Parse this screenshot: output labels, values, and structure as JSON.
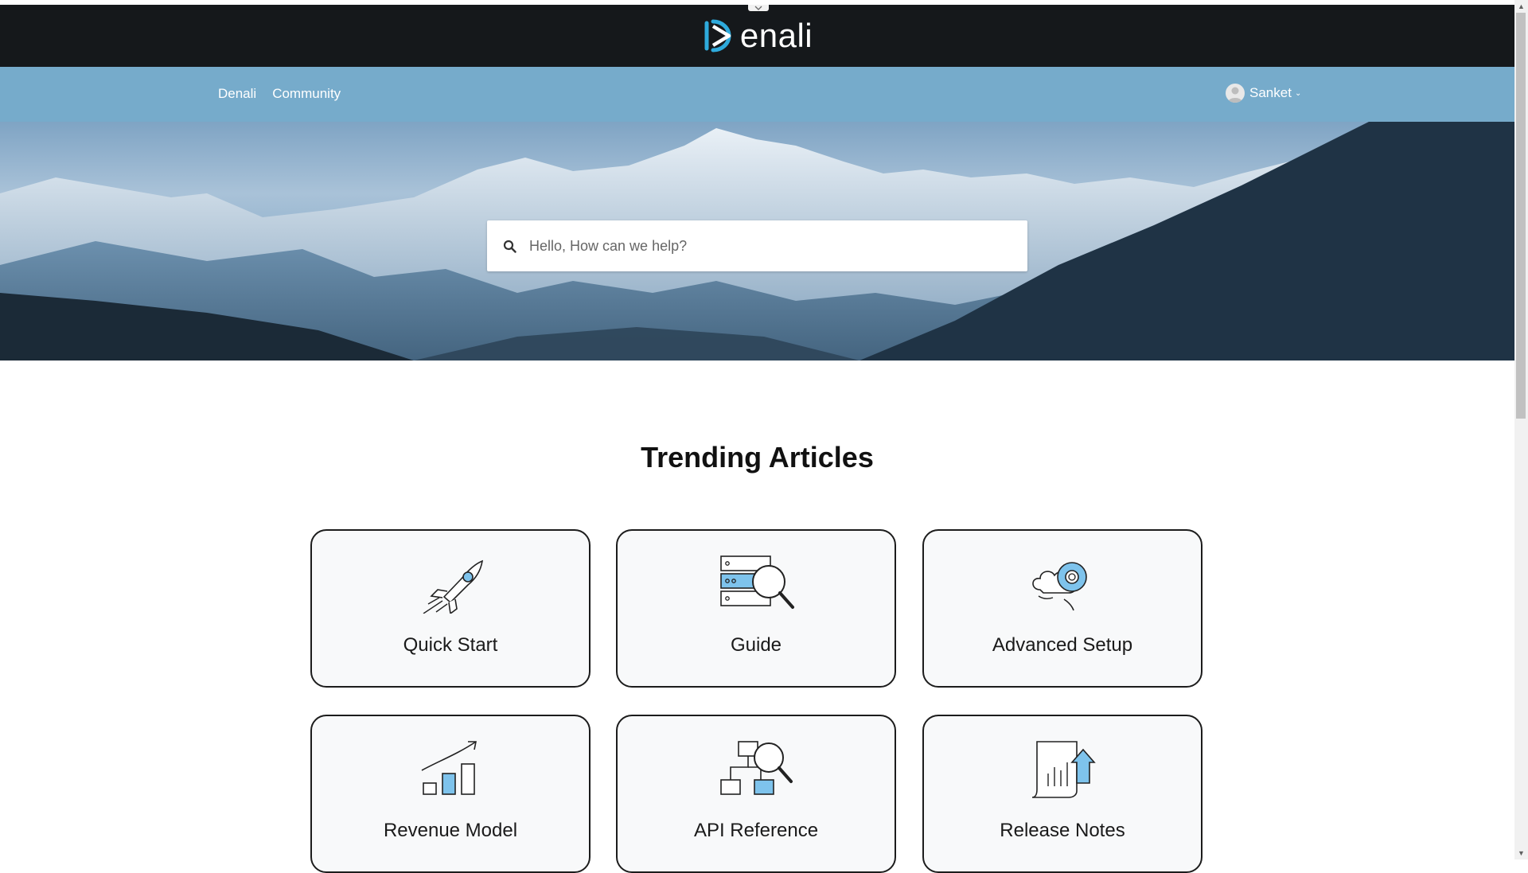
{
  "brand": {
    "logo_text": "enali"
  },
  "nav": {
    "links": [
      "Denali",
      "Community"
    ]
  },
  "user": {
    "name": "Sanket"
  },
  "search": {
    "placeholder": "Hello, How can we help?"
  },
  "trending": {
    "title": "Trending Articles",
    "cards": [
      {
        "label": "Quick Start",
        "icon": "rocket-icon"
      },
      {
        "label": "Guide",
        "icon": "server-search-icon"
      },
      {
        "label": "Advanced Setup",
        "icon": "gear-cloud-icon"
      },
      {
        "label": "Revenue Model",
        "icon": "growth-chart-icon"
      },
      {
        "label": "API Reference",
        "icon": "diagram-search-icon"
      },
      {
        "label": "Release Notes",
        "icon": "document-upload-icon"
      }
    ]
  },
  "colors": {
    "topbar": "#15181b",
    "navbar": "#76abcb",
    "accent": "#2eaadc",
    "icon_fill": "#7ec3ec"
  }
}
